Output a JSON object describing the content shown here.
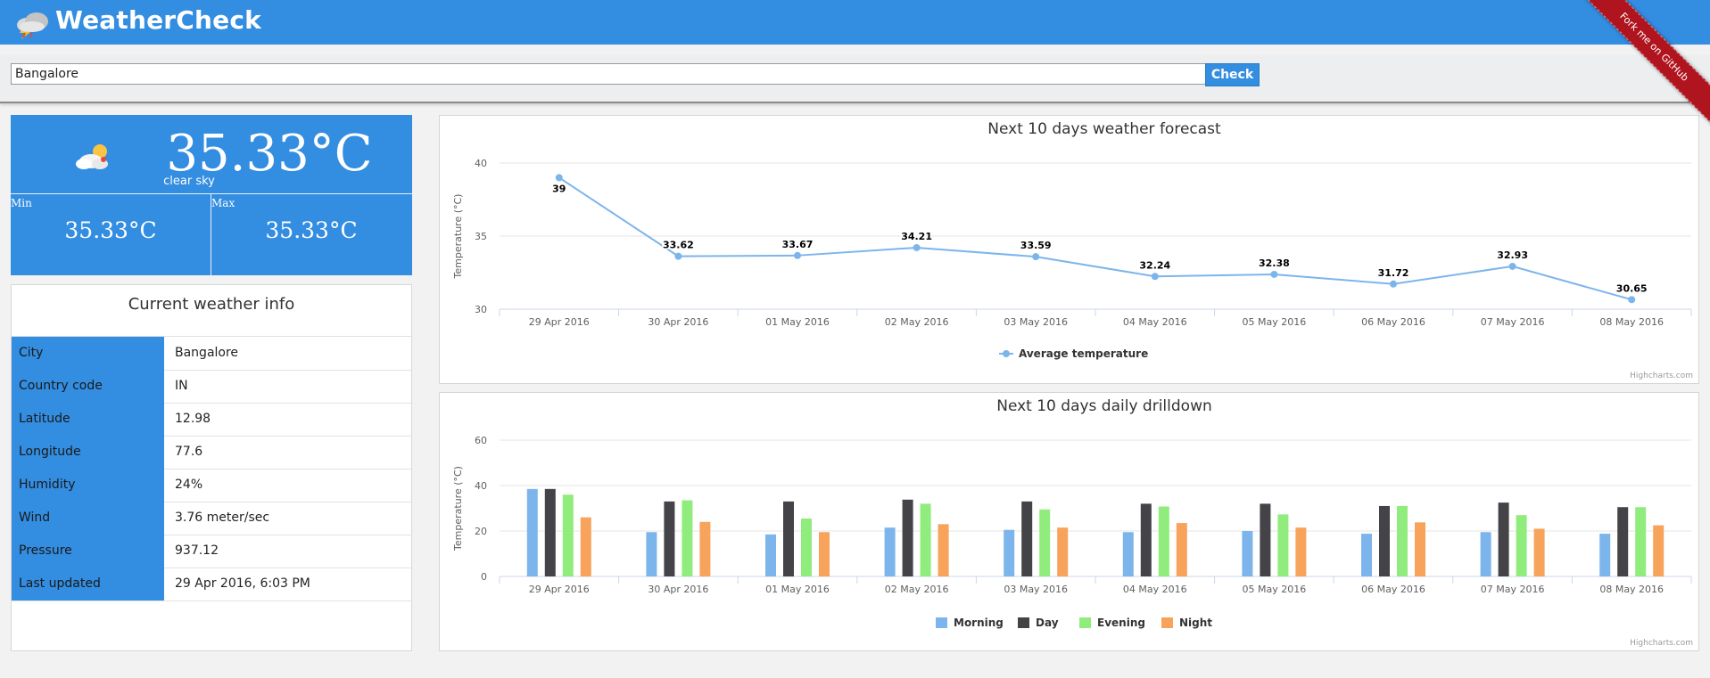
{
  "app": {
    "title": "WeatherCheck",
    "logo_icon": "storm-cloud-icon",
    "ribbon": "Fork me on GitHub"
  },
  "search": {
    "value": "Bangalore",
    "button": "Check"
  },
  "current": {
    "icon": "sun-behind-cloud-icon",
    "temp": "35.33°C",
    "desc": "clear sky",
    "min_label": "Min",
    "min_value": "35.33°C",
    "max_label": "Max",
    "max_value": "35.33°C"
  },
  "info": {
    "title": "Current weather info",
    "rows": [
      {
        "key": "City",
        "value": "Bangalore"
      },
      {
        "key": "Country code",
        "value": "IN"
      },
      {
        "key": "Latitude",
        "value": "12.98"
      },
      {
        "key": "Longitude",
        "value": "77.6"
      },
      {
        "key": "Humidity",
        "value": "24%"
      },
      {
        "key": "Wind",
        "value": "3.76 meter/sec"
      },
      {
        "key": "Pressure",
        "value": "937.12"
      },
      {
        "key": "Last updated",
        "value": "29 Apr 2016, 6:03 PM"
      }
    ]
  },
  "colors": {
    "brand": "#338de0",
    "ribbon": "#b0141f",
    "line": "#7cb5ec",
    "morning": "#7cb5ec",
    "day": "#434348",
    "evening": "#90ed7d",
    "night": "#f7a35c"
  },
  "chart_data": [
    {
      "type": "line",
      "title": "Next 10 days weather forecast",
      "ylabel": "Temperature (°C)",
      "xlabel": "",
      "categories": [
        "29 Apr 2016",
        "30 Apr 2016",
        "01 May 2016",
        "02 May 2016",
        "03 May 2016",
        "04 May 2016",
        "05 May 2016",
        "06 May 2016",
        "07 May 2016",
        "08 May 2016"
      ],
      "yticks": [
        30,
        35,
        40
      ],
      "ylim": [
        30,
        40
      ],
      "series": [
        {
          "name": "Average temperature",
          "values": [
            39,
            33.62,
            33.67,
            34.21,
            33.59,
            32.24,
            32.38,
            31.72,
            32.93,
            30.65
          ]
        }
      ],
      "data_labels": [
        "39",
        "33.62",
        "33.67",
        "34.21",
        "33.59",
        "32.24",
        "32.38",
        "31.72",
        "32.93",
        "30.65"
      ],
      "legend": "bottom-center",
      "credits": "Highcharts.com",
      "grid": true
    },
    {
      "type": "bar",
      "title": "Next 10 days daily drilldown",
      "ylabel": "Temperature (°C)",
      "xlabel": "",
      "categories": [
        "29 Apr 2016",
        "30 Apr 2016",
        "01 May 2016",
        "02 May 2016",
        "03 May 2016",
        "04 May 2016",
        "05 May 2016",
        "06 May 2016",
        "07 May 2016",
        "08 May 2016"
      ],
      "yticks": [
        0,
        20,
        40,
        60
      ],
      "ylim": [
        0,
        60
      ],
      "series": [
        {
          "name": "Morning",
          "values": [
            38.5,
            19.5,
            18.5,
            21.5,
            20.5,
            19.5,
            20.0,
            18.8,
            19.5,
            18.8
          ]
        },
        {
          "name": "Day",
          "values": [
            38.5,
            33.0,
            33.0,
            33.8,
            33.0,
            32.0,
            32.0,
            31.0,
            32.5,
            30.5
          ]
        },
        {
          "name": "Evening",
          "values": [
            36.0,
            33.5,
            25.5,
            32.0,
            29.5,
            30.8,
            27.3,
            31.0,
            27.0,
            30.5
          ]
        },
        {
          "name": "Night",
          "values": [
            26.0,
            24.0,
            19.5,
            23.0,
            21.5,
            23.5,
            21.5,
            23.8,
            21.0,
            22.5
          ]
        }
      ],
      "legend": "bottom-center",
      "credits": "Highcharts.com",
      "grid": true
    }
  ]
}
